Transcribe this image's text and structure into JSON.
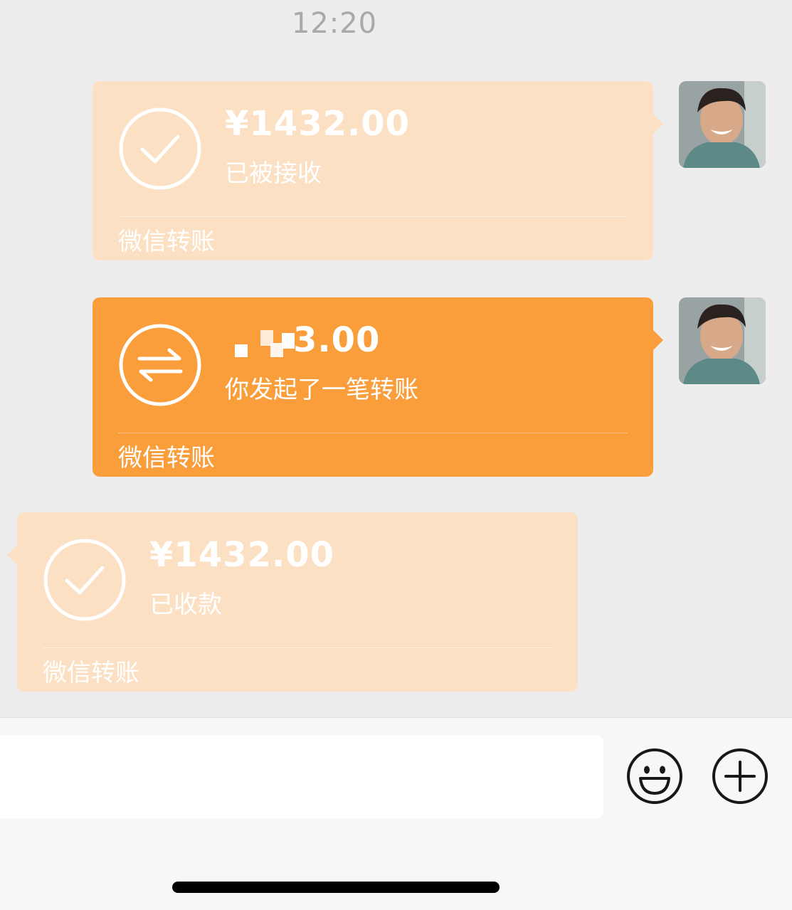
{
  "chat": {
    "timestamp": "12:20",
    "messages": [
      {
        "amount": "¥1432.00",
        "status": "已被接收",
        "footer": "微信转账",
        "state": "accepted",
        "icon": "checkmark-circle-icon"
      },
      {
        "amount": "3.00",
        "status": "你发起了一笔转账",
        "footer": "微信转账",
        "state": "pending",
        "icon": "transfer-arrows-icon"
      },
      {
        "amount": "¥1432.00",
        "status": "已收款",
        "footer": "微信转账",
        "state": "received",
        "icon": "checkmark-circle-icon"
      }
    ]
  },
  "input_bar": {
    "placeholder": "",
    "emoji_icon": "smiley-face-icon",
    "more_icon": "plus-circle-icon"
  },
  "colors": {
    "background": "#ededed",
    "transfer_active": "#fa9d3b",
    "transfer_faded": "#fce0c3",
    "timestamp": "#a9a9a9"
  }
}
